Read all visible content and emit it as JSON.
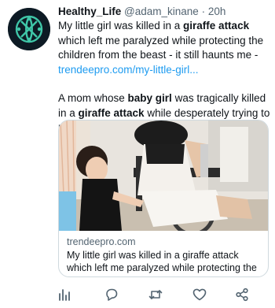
{
  "tweet": {
    "display_name": "Healthy_Life",
    "handle": "@adam_kinane",
    "separator": "·",
    "time": "20h",
    "para1": {
      "pre": "My little girl was killed in a ",
      "bold": "giraffe attack",
      "post": " which left me paralyzed while protecting the children from the beast - it still haunts me - "
    },
    "link_text": "trendeepro.com/my-little-girl...",
    "para2": {
      "t1": "A mom whose ",
      "b1": "baby girl",
      "t2": " was tragically killed in a ",
      "b2": "giraffe attack",
      "t3": " while desperately trying to protect her children f..."
    }
  },
  "card": {
    "domain": "trendeepro.com",
    "title": "My little girl was killed in a giraffe attack which left me paralyzed while protecting the ..."
  },
  "actions": {
    "icons": [
      "analytics-icon",
      "reply-icon",
      "retweet-icon",
      "like-icon",
      "share-icon"
    ]
  },
  "colors": {
    "link": "#1d9bf0",
    "muted": "#536471",
    "text": "#0f1419",
    "border": "#cfd9de"
  }
}
